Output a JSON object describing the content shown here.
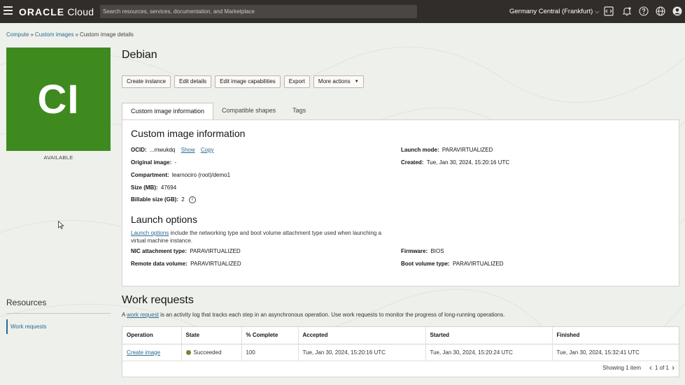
{
  "topbar": {
    "brand_prefix": "ORACLE",
    "brand_suffix": " Cloud",
    "search_placeholder": "Search resources, services, documentation, and Marketplace",
    "region": "Germany Central (Frankfurt)"
  },
  "breadcrumb": {
    "items": [
      "Compute",
      "Custom images",
      "Custom image details"
    ],
    "separator": "»"
  },
  "tile": {
    "initials": "CI",
    "status": "AVAILABLE",
    "color": "#3f8a1f"
  },
  "resources": {
    "title": "Resources",
    "items": [
      "Work requests"
    ]
  },
  "page": {
    "title": "Debian"
  },
  "actions": {
    "create_instance": "Create instance",
    "edit_details": "Edit details",
    "edit_capabilities": "Edit image capabilities",
    "export": "Export",
    "more_actions": "More actions"
  },
  "tabs": [
    "Custom image information",
    "Compatible shapes",
    "Tags"
  ],
  "info": {
    "heading": "Custom image information",
    "ocid_label": "OCID:",
    "ocid_value": "...mwukdq",
    "show": "Show",
    "copy": "Copy",
    "original_image_label": "Original image:",
    "original_image_value": "-",
    "compartment_label": "Compartment:",
    "compartment_value": "learnociro (root)/demo1",
    "size_label": "Size (MB):",
    "size_value": "47694",
    "billable_label": "Billable size (GB):",
    "billable_value": "2",
    "launch_mode_label": "Launch mode:",
    "launch_mode_value": "PARAVIRTUALIZED",
    "created_label": "Created:",
    "created_value": "Tue, Jan 30, 2024, 15:20:16 UTC"
  },
  "launch": {
    "heading": "Launch options",
    "link": "Launch options",
    "desc_rest": " include the networking type and boot volume attachment type used when launching a virtual machine instance.",
    "nic_label": "NIC attachment type:",
    "nic_value": "PARAVIRTUALIZED",
    "remote_label": "Remote data volume:",
    "remote_value": "PARAVIRTUALIZED",
    "firmware_label": "Firmware:",
    "firmware_value": "BIOS",
    "boot_label": "Boot volume type:",
    "boot_value": "PARAVIRTUALIZED"
  },
  "work_requests": {
    "title": "Work requests",
    "desc_prefix": "A ",
    "desc_link": "work request",
    "desc_suffix": " is an activity log that tracks each step in an asynchronous operation. Use work requests to monitor the progress of long-running operations.",
    "columns": [
      "Operation",
      "State",
      "% Complete",
      "Accepted",
      "Started",
      "Finished"
    ],
    "rows": [
      {
        "operation": "Create image",
        "state": "Succeeded",
        "complete": "100",
        "accepted": "Tue, Jan 30, 2024, 15:20:16 UTC",
        "started": "Tue, Jan 30, 2024, 15:20:24 UTC",
        "finished": "Tue, Jan 30, 2024, 15:32:41 UTC"
      }
    ],
    "showing": "Showing 1 item",
    "page": "1 of 1"
  }
}
